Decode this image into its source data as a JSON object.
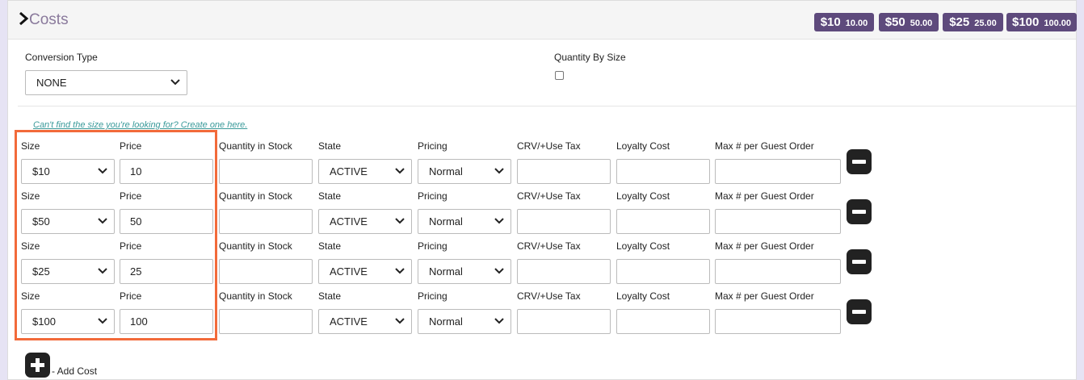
{
  "header": {
    "title": "Costs",
    "badges": [
      {
        "big": "$10",
        "small": "10.00"
      },
      {
        "big": "$50",
        "small": "50.00"
      },
      {
        "big": "$25",
        "small": "25.00"
      },
      {
        "big": "$100",
        "small": "100.00"
      }
    ]
  },
  "settings": {
    "conversion_type_label": "Conversion Type",
    "conversion_type_value": "NONE",
    "quantity_by_size_label": "Quantity By Size",
    "quantity_by_size_checked": false
  },
  "create_size_link": "Can't find the size you're looking for? Create one here.",
  "columns": {
    "size": "Size",
    "price": "Price",
    "quantity": "Quantity in Stock",
    "state": "State",
    "pricing": "Pricing",
    "crv": "CRV/+Use Tax",
    "loyalty": "Loyalty Cost",
    "max_guest": "Max # per Guest Order"
  },
  "rows": [
    {
      "size": "$10",
      "price": "10",
      "quantity": "",
      "state": "ACTIVE",
      "pricing": "Normal",
      "crv": "",
      "loyalty": "",
      "max_guest": ""
    },
    {
      "size": "$50",
      "price": "50",
      "quantity": "",
      "state": "ACTIVE",
      "pricing": "Normal",
      "crv": "",
      "loyalty": "",
      "max_guest": ""
    },
    {
      "size": "$25",
      "price": "25",
      "quantity": "",
      "state": "ACTIVE",
      "pricing": "Normal",
      "crv": "",
      "loyalty": "",
      "max_guest": ""
    },
    {
      "size": "$100",
      "price": "100",
      "quantity": "",
      "state": "ACTIVE",
      "pricing": "Normal",
      "crv": "",
      "loyalty": "",
      "max_guest": ""
    }
  ],
  "add_cost_label": "- Add Cost",
  "icons": {
    "collapse": "chevron-right-icon",
    "remove": "minus-icon",
    "add": "plus-icon",
    "dropdown": "caret-down-icon"
  },
  "colors": {
    "badge": "#5e4a7c",
    "title": "#8a7a9c",
    "link": "#3a9a9a",
    "highlight": "#f26a3a"
  }
}
